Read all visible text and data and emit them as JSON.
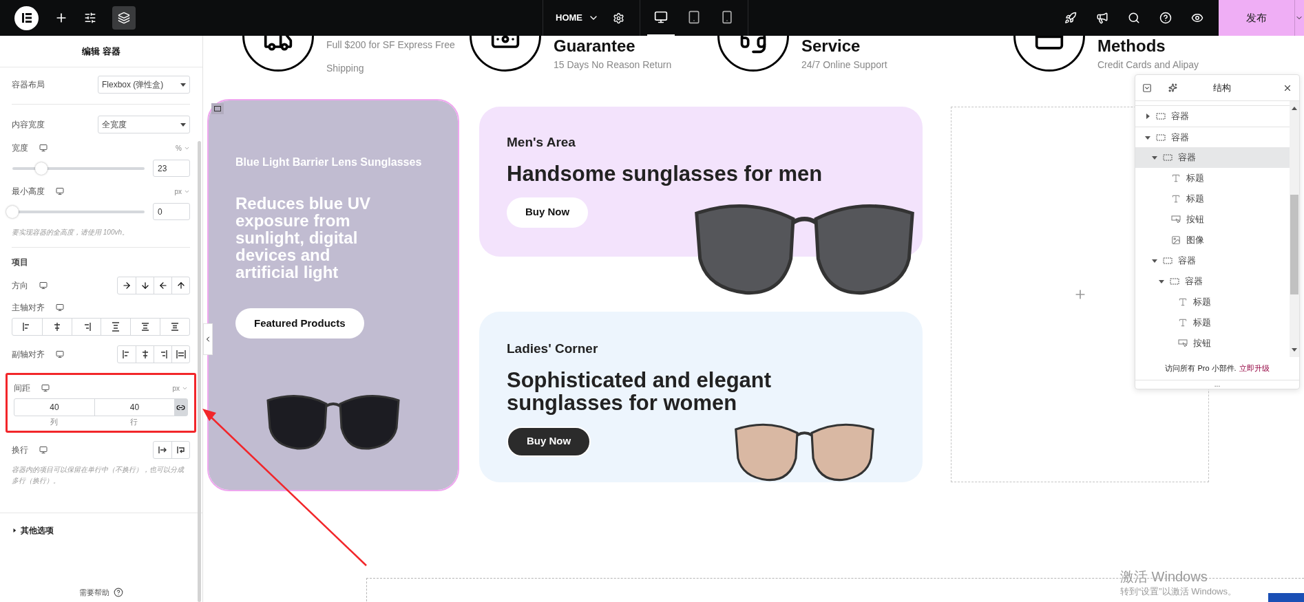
{
  "topbar": {
    "page": "HOME",
    "devices": [
      {
        "kind": "desktop",
        "selected": true
      },
      {
        "kind": "tablet",
        "selected": false
      },
      {
        "kind": "mobile",
        "selected": false
      }
    ],
    "publish": "发布"
  },
  "panel": {
    "title": "编辑 容器",
    "layout": {
      "label": "容器布局",
      "value": "Flexbox (弹性盒)"
    },
    "content_width": {
      "label": "内容宽度",
      "value": "全宽度"
    },
    "width": {
      "label": "宽度",
      "unit": "%",
      "value": "23",
      "level": 0.23
    },
    "min_height": {
      "label": "最小高度",
      "unit": "px",
      "value": "0",
      "level": 0,
      "hint": "要实现容器的全高度，请使用 100vh。"
    },
    "section": "项目",
    "direction": {
      "label": "方向"
    },
    "justify": {
      "label": "主轴对齐"
    },
    "align": {
      "label": "副轴对齐"
    },
    "gap": {
      "label": "间距",
      "unit": "px",
      "column": "40",
      "row": "40",
      "column_label": "列",
      "row_label": "行",
      "linked": true
    },
    "wrap": {
      "label": "换行",
      "hint": "容器内的项目可以保留在单行中（不换行），也可以分成多行（换行）。"
    },
    "more": {
      "label": "其他选项",
      "expanded": false
    },
    "help": "需要帮助"
  },
  "features": [
    {
      "text": "Full $200 for SF Express Free Shipping"
    },
    {
      "title": "Guarantee",
      "text": "15 Days No Reason Return"
    },
    {
      "title": "Service",
      "text": "24/7 Online Support"
    },
    {
      "title": "Methods",
      "text": "Credit Cards and Alipay"
    }
  ],
  "promo": {
    "title": "Blue Light Barrier Lens Sunglasses",
    "text": "Reduces blue UV exposure from sunlight, digital devices and artificial light",
    "button": "Featured Products",
    "selected": true
  },
  "cards": [
    {
      "kind": "light",
      "color": "#f3e3fc",
      "subtitle": "Men's Area",
      "title": "Handsome sunglasses for men",
      "button": "Buy Now"
    },
    {
      "kind": "dark",
      "color": "#edf5fd",
      "subtitle": "Ladies' Corner",
      "title": "Sophisticated and elegant sunglasses for women",
      "button": "Buy Now"
    }
  ],
  "structure": {
    "title": "结构",
    "tree": [
      {
        "kind": "container",
        "label": "容器",
        "expanded": false,
        "selected": false
      },
      {
        "kind": "container",
        "label": "容器",
        "expanded": true,
        "selected": false,
        "children": [
          {
            "kind": "container",
            "label": "容器",
            "expanded": true,
            "selected": true,
            "children": [
              {
                "kind": "heading",
                "label": "标题",
                "selected": false
              },
              {
                "kind": "heading",
                "label": "标题",
                "selected": false
              },
              {
                "kind": "button",
                "label": "按钮",
                "selected": false
              },
              {
                "kind": "image",
                "label": "图像",
                "selected": false
              }
            ]
          },
          {
            "kind": "container",
            "label": "容器",
            "expanded": true,
            "selected": false,
            "children": [
              {
                "kind": "container",
                "label": "容器",
                "expanded": true,
                "selected": false,
                "children": [
                  {
                    "kind": "heading",
                    "label": "标题",
                    "selected": false
                  },
                  {
                    "kind": "heading",
                    "label": "标题",
                    "selected": false
                  },
                  {
                    "kind": "button",
                    "label": "按钮",
                    "selected": false
                  }
                ]
              }
            ]
          }
        ]
      }
    ],
    "footer": "访问所有 Pro 小部件.",
    "upgrade": "立即升级",
    "more": "..."
  },
  "os_watermark": {
    "title": "激活 Windows",
    "text": "转到“设置”以激活 Windows。"
  }
}
